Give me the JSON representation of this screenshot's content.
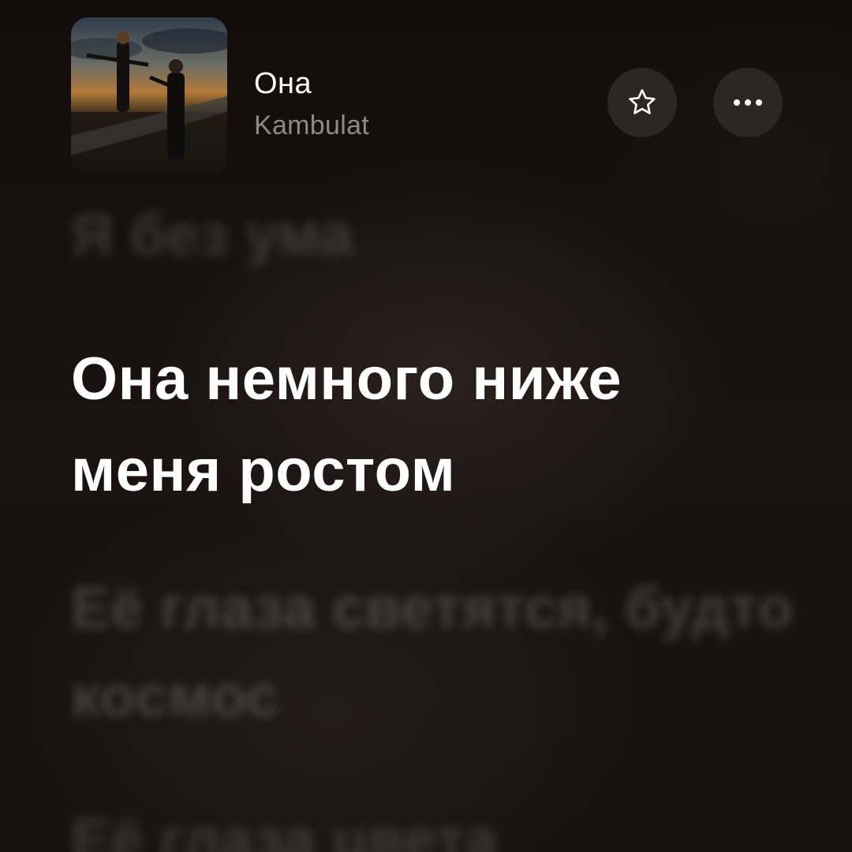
{
  "track": {
    "title": "Она",
    "artist": "Kambulat"
  },
  "actions": {
    "favorite_icon": "star-icon",
    "more_icon": "ellipsis-icon"
  },
  "lyrics": {
    "previous": "Я без ума",
    "current": "Она немного ниже меня ростом",
    "next": "Её глаза светятся, будто космос",
    "after": "Её глаза цвета"
  },
  "colors": {
    "background": "#15100f",
    "button_bg": "#2c2624",
    "artist_text": "#8e8886",
    "active_lyric": "#ffffff"
  }
}
